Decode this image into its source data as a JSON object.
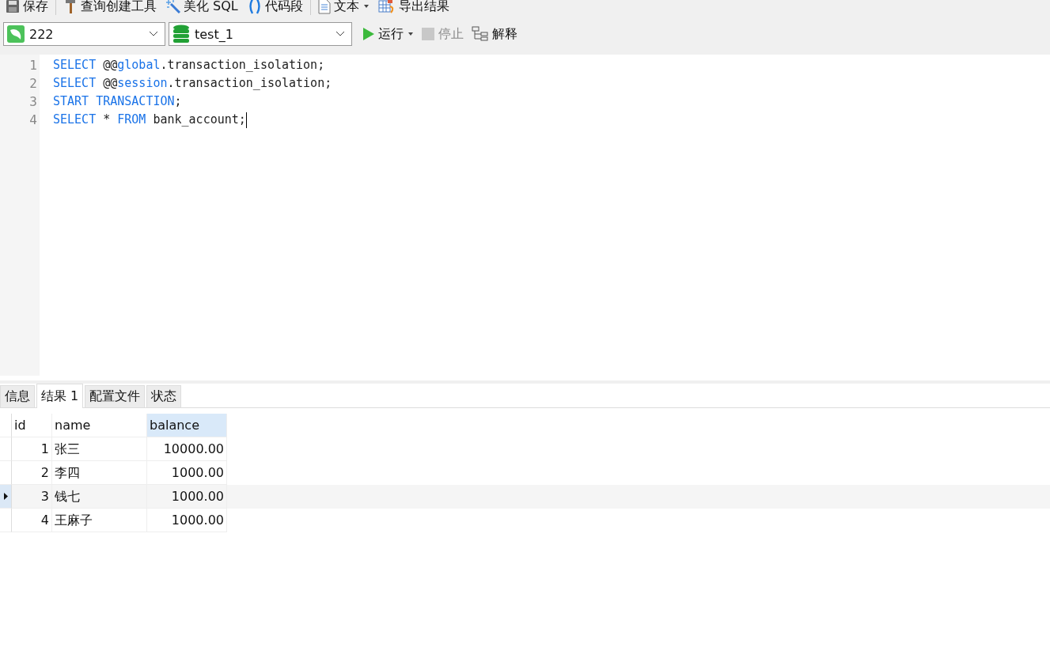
{
  "toolbar": [
    {
      "kind": "save",
      "label": "保存",
      "dropdown": false
    },
    {
      "kind": "builder",
      "label": "查询创建工具",
      "dropdown": false
    },
    {
      "kind": "beautify",
      "label": "美化 SQL",
      "dropdown": false
    },
    {
      "kind": "snippet",
      "label": "代码段",
      "dropdown": false
    },
    {
      "kind": "text",
      "label": "文本",
      "dropdown": true
    },
    {
      "kind": "export",
      "label": "导出结果",
      "dropdown": false
    }
  ],
  "connection": {
    "value": "222"
  },
  "database": {
    "value": "test_1"
  },
  "actions": [
    {
      "kind": "run",
      "label": "运行",
      "dropdown": true,
      "disabled": false
    },
    {
      "kind": "stop",
      "label": "停止",
      "dropdown": false,
      "disabled": true
    },
    {
      "kind": "explain",
      "label": "解释",
      "dropdown": false,
      "disabled": false
    }
  ],
  "editor": {
    "lines": [
      {
        "number": "1",
        "cursor": false,
        "tokens": [
          {
            "text": "SELECT ",
            "kind": "keyword"
          },
          {
            "text": "@@",
            "kind": "plain"
          },
          {
            "text": "global",
            "kind": "keyword"
          },
          {
            "text": ".transaction_isolation;",
            "kind": "plain"
          }
        ]
      },
      {
        "number": "2",
        "cursor": false,
        "tokens": [
          {
            "text": "SELECT ",
            "kind": "keyword"
          },
          {
            "text": "@@",
            "kind": "plain"
          },
          {
            "text": "session",
            "kind": "keyword"
          },
          {
            "text": ".transaction_isolation;",
            "kind": "plain"
          }
        ]
      },
      {
        "number": "3",
        "cursor": false,
        "tokens": [
          {
            "text": "START TRANSACTION",
            "kind": "keyword"
          },
          {
            "text": ";",
            "kind": "plain"
          }
        ]
      },
      {
        "number": "4",
        "cursor": true,
        "tokens": [
          {
            "text": "SELECT ",
            "kind": "keyword"
          },
          {
            "text": "* ",
            "kind": "plain"
          },
          {
            "text": "FROM ",
            "kind": "keyword"
          },
          {
            "text": "bank_account;",
            "kind": "plain"
          }
        ]
      }
    ]
  },
  "result_tabs": [
    {
      "label": "信息",
      "selected": false
    },
    {
      "label": "结果 1",
      "selected": true
    },
    {
      "label": "配置文件",
      "selected": false
    },
    {
      "label": "状态",
      "selected": false
    }
  ],
  "table": {
    "columns": [
      {
        "label": "id",
        "selected": false
      },
      {
        "label": "name",
        "selected": false
      },
      {
        "label": "balance",
        "selected": true
      }
    ],
    "rows": [
      {
        "selected": false,
        "cells": [
          "1",
          "张三",
          "10000.00"
        ]
      },
      {
        "selected": false,
        "cells": [
          "2",
          "李四",
          "1000.00"
        ]
      },
      {
        "selected": true,
        "cells": [
          "3",
          "钱七",
          "1000.00"
        ]
      },
      {
        "selected": false,
        "cells": [
          "4",
          "王麻子",
          "1000.00"
        ]
      }
    ]
  }
}
